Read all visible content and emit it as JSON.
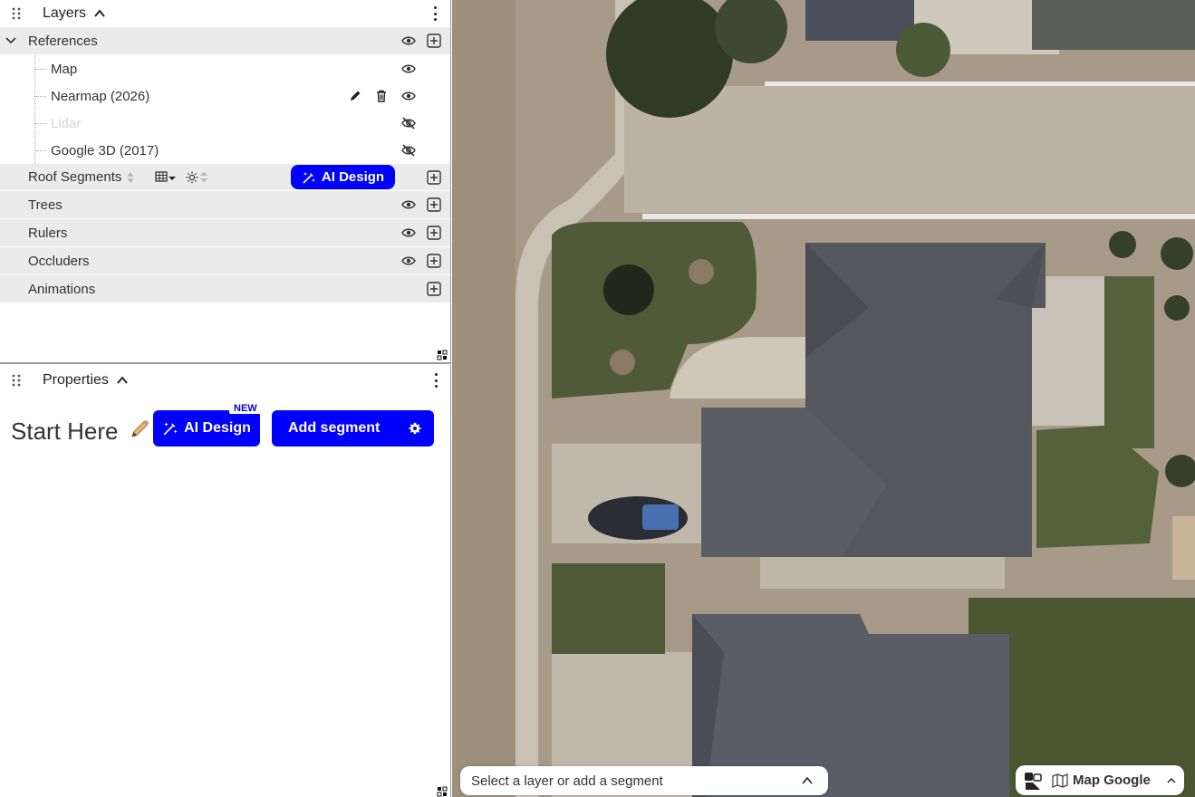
{
  "layers_panel": {
    "title": "Layers",
    "groups": {
      "references": {
        "label": "References",
        "children": [
          {
            "label": "Map",
            "visible": true
          },
          {
            "label": "Nearmap (2026)",
            "visible": true
          },
          {
            "label": "Lidar",
            "visible": false,
            "disabled": true
          },
          {
            "label": "Google 3D (2017)",
            "visible": false
          }
        ]
      },
      "roof_segments": {
        "label": "Roof Segments",
        "ai_button": "AI Design"
      },
      "trees": {
        "label": "Trees"
      },
      "rulers": {
        "label": "Rulers"
      },
      "occluders": {
        "label": "Occluders"
      },
      "animations": {
        "label": "Animations"
      }
    }
  },
  "properties_panel": {
    "title": "Properties",
    "start_title": "Start Here",
    "ai_button": "AI Design",
    "new_badge": "NEW",
    "add_segment": "Add segment"
  },
  "map": {
    "status_text": "Select a layer or add a segment",
    "map_source": "Map Google"
  },
  "colors": {
    "accent": "#0000ff",
    "group_bg": "#ebebeb"
  }
}
